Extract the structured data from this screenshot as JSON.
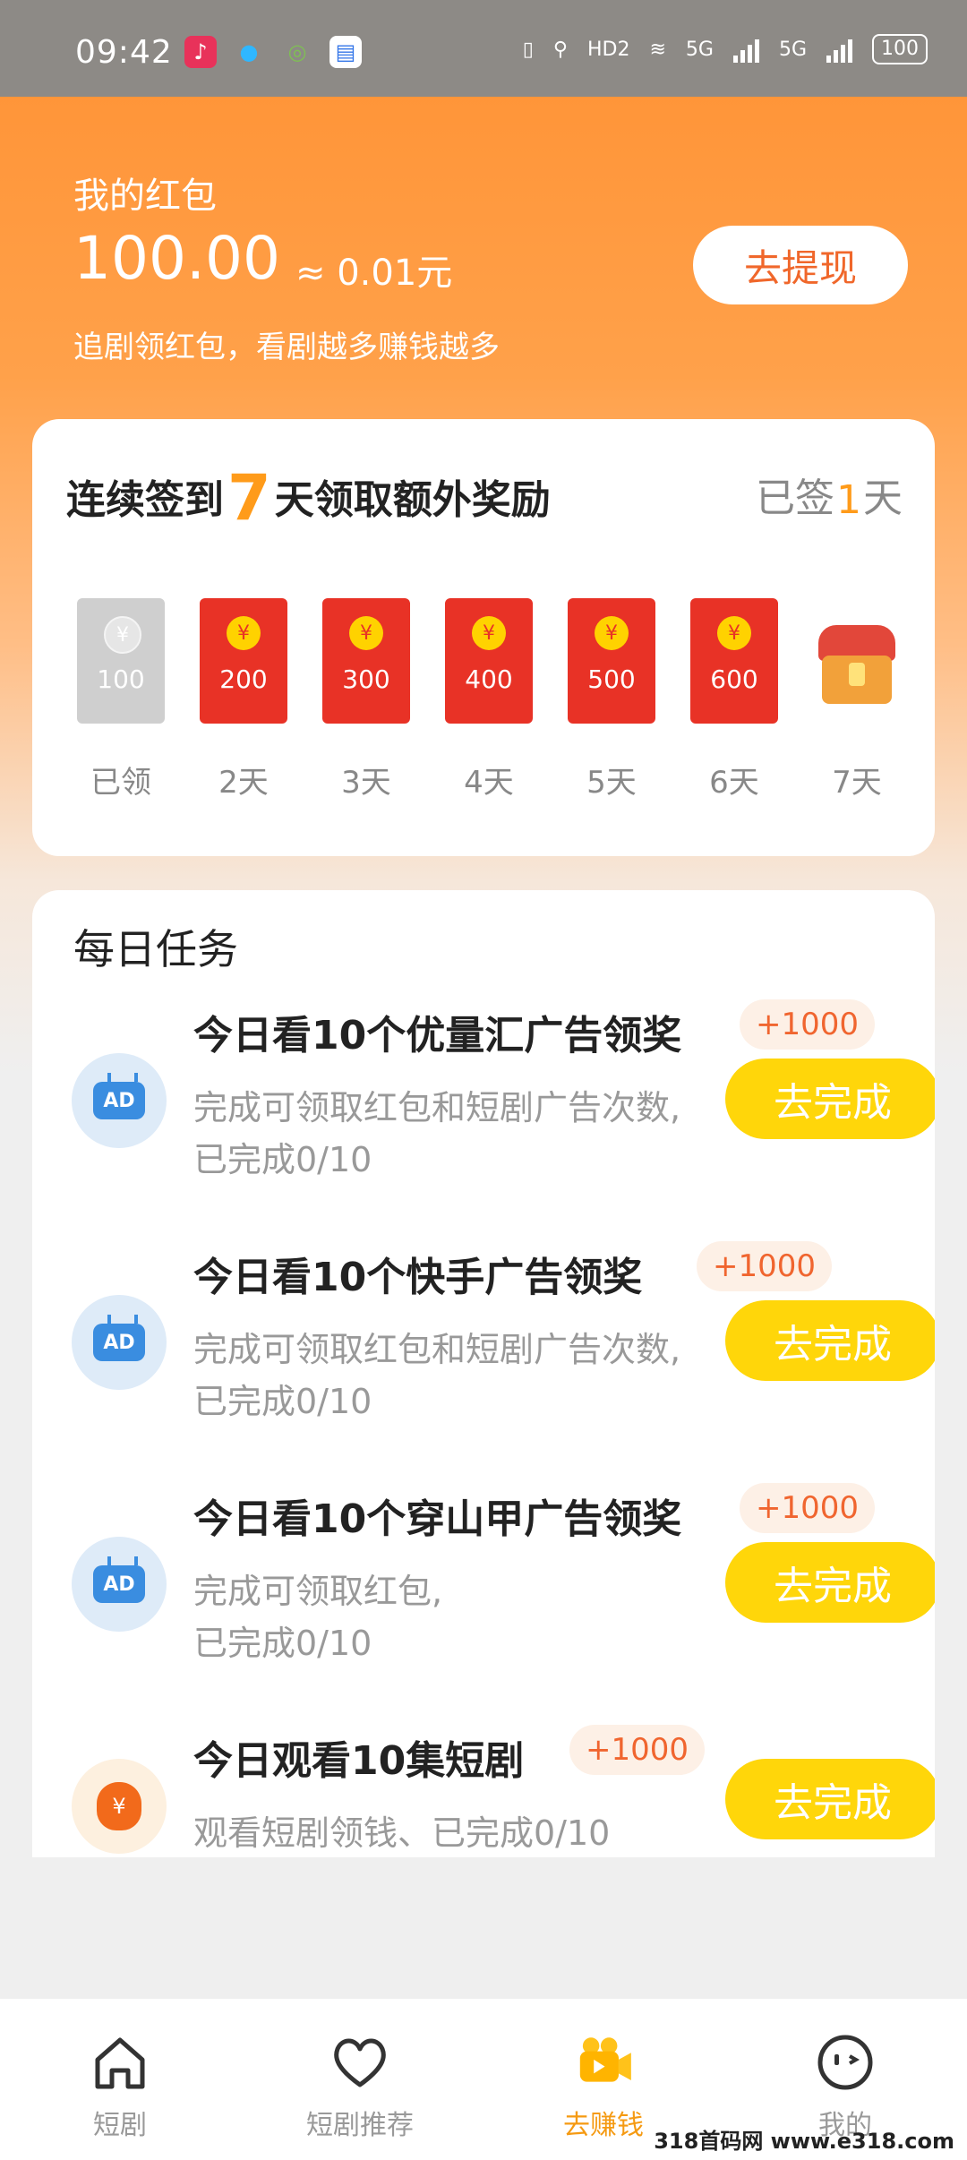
{
  "status_bar": {
    "time": "09:42",
    "network_labels": [
      "HD2",
      "5G",
      "5G"
    ],
    "battery": "100"
  },
  "header": {
    "title": "我的红包",
    "amount": "100.00",
    "approx": "≈ 0.01元",
    "subtitle": "追剧领红包，看剧越多赚钱越多",
    "withdraw_label": "去提现"
  },
  "sign_in": {
    "title_prefix": "连续签到",
    "title_days": "7",
    "title_suffix": "天领取额外奖励",
    "signed_prefix": "已签",
    "signed_days": "1",
    "signed_suffix": "天",
    "rewards": [
      {
        "amount": "100",
        "day": "已领",
        "state": "claimed"
      },
      {
        "amount": "200",
        "day": "2天",
        "state": "pending"
      },
      {
        "amount": "300",
        "day": "3天",
        "state": "pending"
      },
      {
        "amount": "400",
        "day": "4天",
        "state": "pending"
      },
      {
        "amount": "500",
        "day": "5天",
        "state": "pending"
      },
      {
        "amount": "600",
        "day": "6天",
        "state": "pending"
      },
      {
        "amount": "",
        "day": "7天",
        "state": "chest"
      }
    ],
    "coin_symbol": "¥"
  },
  "tasks": {
    "heading": "每日任务",
    "items": [
      {
        "title": "今日看10个优量汇广告领奖",
        "bonus": "+1000",
        "desc1": "完成可领取红包和短剧广告次数,",
        "desc2": "已完成0/10",
        "button": "去完成",
        "icon": "ad-tv-icon"
      },
      {
        "title": "今日看10个快手广告领奖",
        "bonus": "+1000",
        "desc1": "完成可领取红包和短剧广告次数,",
        "desc2": "已完成0/10",
        "button": "去完成",
        "icon": "ad-tv-icon"
      },
      {
        "title": "今日看10个穿山甲广告领奖",
        "bonus": "+1000",
        "desc1": "完成可领取红包,",
        "desc2": "已完成0/10",
        "button": "去完成",
        "icon": "ad-tv-icon"
      },
      {
        "title": "今日观看10集短剧",
        "bonus": "+1000",
        "desc1": "观看短剧领钱、已完成0/10",
        "desc2": "",
        "button": "去完成",
        "icon": "money-bag-icon"
      }
    ],
    "ad_text": "AD"
  },
  "bottom_nav": {
    "items": [
      {
        "label": "短剧",
        "icon": "home-icon"
      },
      {
        "label": "短剧推荐",
        "icon": "heart-icon"
      },
      {
        "label": "去赚钱",
        "icon": "video-camera-icon",
        "active": true
      },
      {
        "label": "我的",
        "icon": "face-icon"
      }
    ]
  },
  "watermark": "318首码网 www.e318.com",
  "colors": {
    "accent": "#ff9133",
    "button_yellow": "#ffd60a",
    "red_envelope": "#e83226"
  }
}
